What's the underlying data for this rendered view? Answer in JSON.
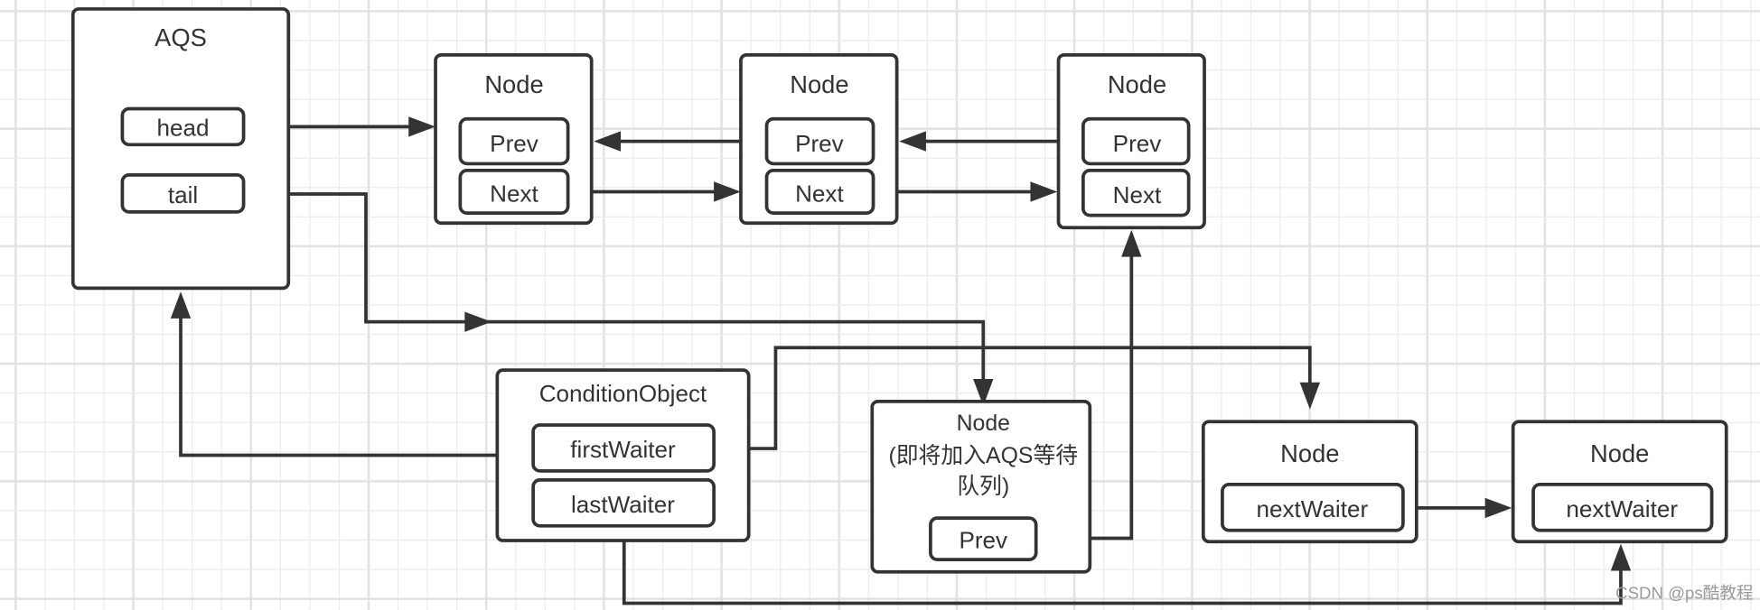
{
  "diagram": {
    "aqs": {
      "title": "AQS",
      "fields": [
        "head",
        "tail"
      ]
    },
    "sync_queue_nodes": [
      {
        "title": "Node",
        "fields": [
          "Prev",
          "Next"
        ]
      },
      {
        "title": "Node",
        "fields": [
          "Prev",
          "Next"
        ]
      },
      {
        "title": "Node",
        "fields": [
          "Prev",
          "Next"
        ]
      }
    ],
    "condition_object": {
      "title": "ConditionObject",
      "fields": [
        "firstWaiter",
        "lastWaiter"
      ]
    },
    "pending_node": {
      "title_lines": [
        "Node",
        "(即将加入AQS等待",
        "队列)"
      ],
      "field": "Prev"
    },
    "condition_queue_nodes": [
      {
        "title": "Node",
        "field": "nextWaiter"
      },
      {
        "title": "Node",
        "field": "nextWaiter"
      }
    ],
    "edges": [
      {
        "from": "aqs.head",
        "to": "sync_queue_nodes.0"
      },
      {
        "from": "sync_queue_nodes.1.Prev",
        "to": "sync_queue_nodes.0"
      },
      {
        "from": "sync_queue_nodes.2.Prev",
        "to": "sync_queue_nodes.1"
      },
      {
        "from": "sync_queue_nodes.0.Next",
        "to": "sync_queue_nodes.1"
      },
      {
        "from": "sync_queue_nodes.1.Next",
        "to": "sync_queue_nodes.2"
      },
      {
        "from": "aqs.tail",
        "to": "pending_node"
      },
      {
        "from": "condition_object",
        "to": "aqs"
      },
      {
        "from": "condition_object.firstWaiter",
        "to": "condition_queue_nodes.0"
      },
      {
        "from": "pending_node.Prev",
        "to": "sync_queue_nodes.2"
      },
      {
        "from": "condition_queue_nodes.0.nextWaiter",
        "to": "condition_queue_nodes.1"
      },
      {
        "from": "condition_object.lastWaiter",
        "to": "condition_queue_nodes.1"
      }
    ],
    "colors": {
      "stroke": "#333333",
      "grid": "#ebebeb",
      "background": "#ffffff"
    }
  },
  "watermark": "CSDN @ps酷教程"
}
